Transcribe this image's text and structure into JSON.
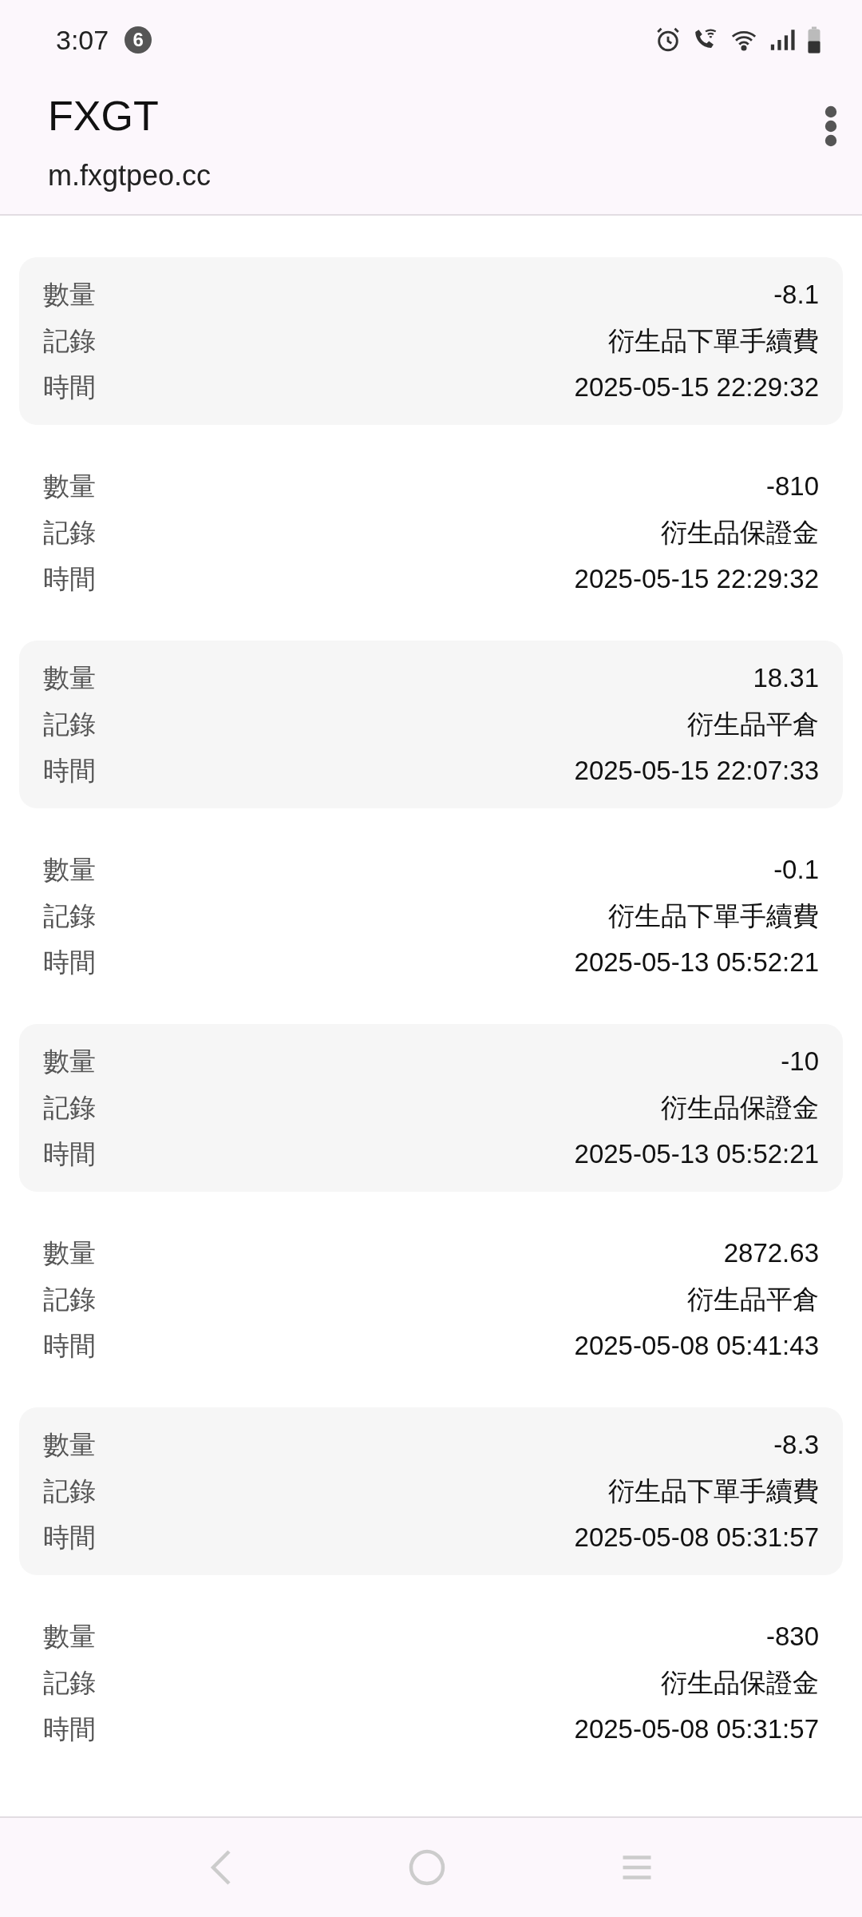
{
  "status_bar": {
    "time": "3:07",
    "notification_count": "6"
  },
  "header": {
    "title": "FXGT",
    "url": "m.fxgtpeo.cc"
  },
  "records": [
    {
      "fields": [
        {
          "label": "數量",
          "value": "-8.1"
        },
        {
          "label": "記錄",
          "value": "衍生品下單手續費"
        },
        {
          "label": "時間",
          "value": "2025-05-15 22:29:32"
        }
      ]
    },
    {
      "fields": [
        {
          "label": "數量",
          "value": "-810"
        },
        {
          "label": "記錄",
          "value": "衍生品保證金"
        },
        {
          "label": "時間",
          "value": "2025-05-15 22:29:32"
        }
      ]
    },
    {
      "fields": [
        {
          "label": "數量",
          "value": "18.31"
        },
        {
          "label": "記錄",
          "value": "衍生品平倉"
        },
        {
          "label": "時間",
          "value": "2025-05-15 22:07:33"
        }
      ]
    },
    {
      "fields": [
        {
          "label": "數量",
          "value": "-0.1"
        },
        {
          "label": "記錄",
          "value": "衍生品下單手續費"
        },
        {
          "label": "時間",
          "value": "2025-05-13 05:52:21"
        }
      ]
    },
    {
      "fields": [
        {
          "label": "數量",
          "value": "-10"
        },
        {
          "label": "記錄",
          "value": "衍生品保證金"
        },
        {
          "label": "時間",
          "value": "2025-05-13 05:52:21"
        }
      ]
    },
    {
      "fields": [
        {
          "label": "數量",
          "value": "2872.63"
        },
        {
          "label": "記錄",
          "value": "衍生品平倉"
        },
        {
          "label": "時間",
          "value": "2025-05-08 05:41:43"
        }
      ]
    },
    {
      "fields": [
        {
          "label": "數量",
          "value": "-8.3"
        },
        {
          "label": "記錄",
          "value": "衍生品下單手續費"
        },
        {
          "label": "時間",
          "value": "2025-05-08 05:31:57"
        }
      ]
    },
    {
      "fields": [
        {
          "label": "數量",
          "value": "-830"
        },
        {
          "label": "記錄",
          "value": "衍生品保證金"
        },
        {
          "label": "時間",
          "value": "2025-05-08 05:31:57"
        }
      ]
    }
  ]
}
